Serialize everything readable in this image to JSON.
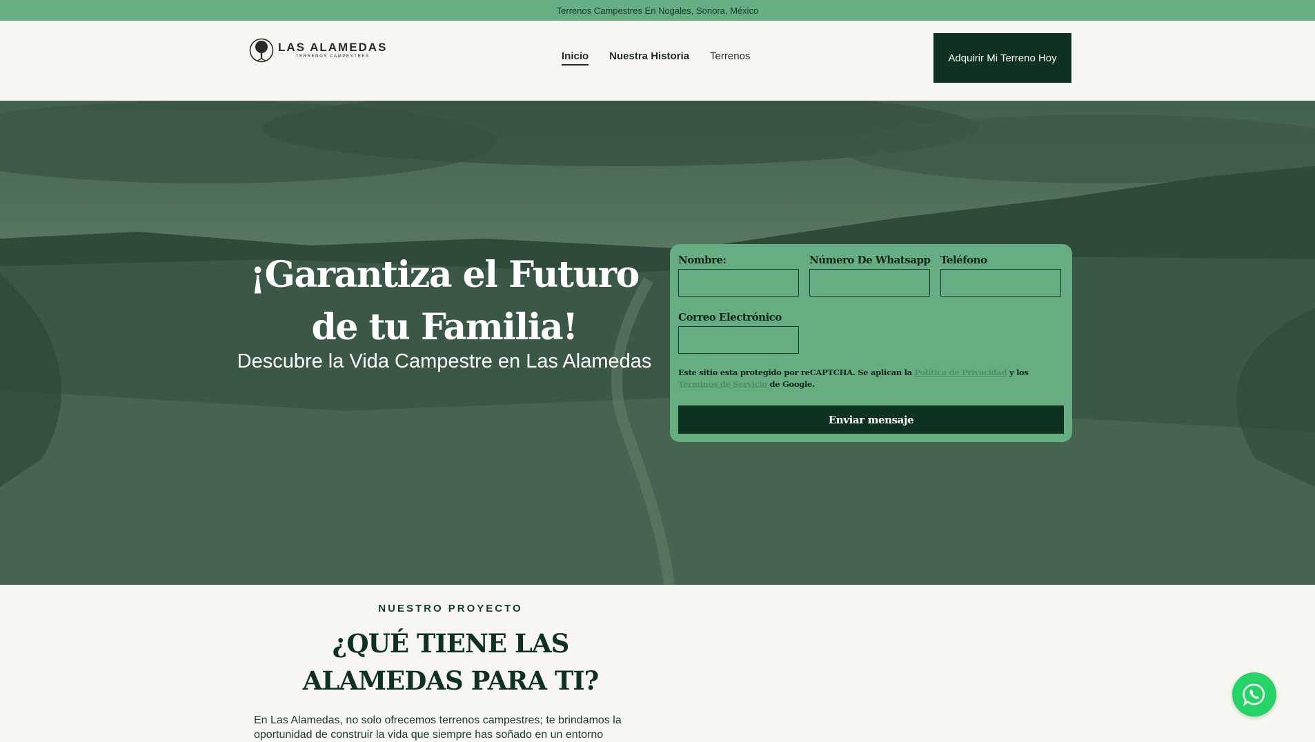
{
  "topbar": {
    "text": "Terrenos Campestres En Nogales, Sonora, México"
  },
  "header": {
    "logo": {
      "name": "LAS ALAMEDAS",
      "subtitle": "TERRENOS CAMPESTRES"
    },
    "nav": [
      {
        "label": "Inicio",
        "active": true
      },
      {
        "label": "Nuestra Historia",
        "active": false
      },
      {
        "label": "Terrenos",
        "active": false
      }
    ],
    "cta_label": "Adquirir Mi Terreno Hoy"
  },
  "hero": {
    "title": "¡Garantiza el Futuro de tu Familia!",
    "subtitle": "Descubre la Vida Campestre en Las Alamedas"
  },
  "form": {
    "fields": [
      {
        "label": "Nombre:",
        "value": ""
      },
      {
        "label": "Número De Whatsapp",
        "value": ""
      },
      {
        "label": "Teléfono",
        "value": ""
      },
      {
        "label": "Correo Electrónico",
        "value": ""
      }
    ],
    "recaptcha": {
      "prefix": "Este sitio esta protegido por reCAPTCHA. Se aplican la",
      "privacy_link": "Política de Privacidad",
      "middle": "y los",
      "terms_link": "Términos de Servicio",
      "suffix": "de Google."
    },
    "submit_label": "Enviar mensaje"
  },
  "project": {
    "eyebrow": "NUESTRO PROYECTO",
    "title": "¿QUÉ TIENE LAS ALAMEDAS PARA TI?",
    "body": "En Las Alamedas, no solo ofrecemos terrenos campestres; te brindamos la oportunidad de construir la vida que siempre has soñado en un entorno"
  },
  "whatsapp": {
    "icon": "whatsapp-icon"
  },
  "colors": {
    "accent_green": "#67ad82",
    "dark_green": "#0e3122",
    "whatsapp_green": "#25d366",
    "page_bg": "#f8f6f0"
  }
}
